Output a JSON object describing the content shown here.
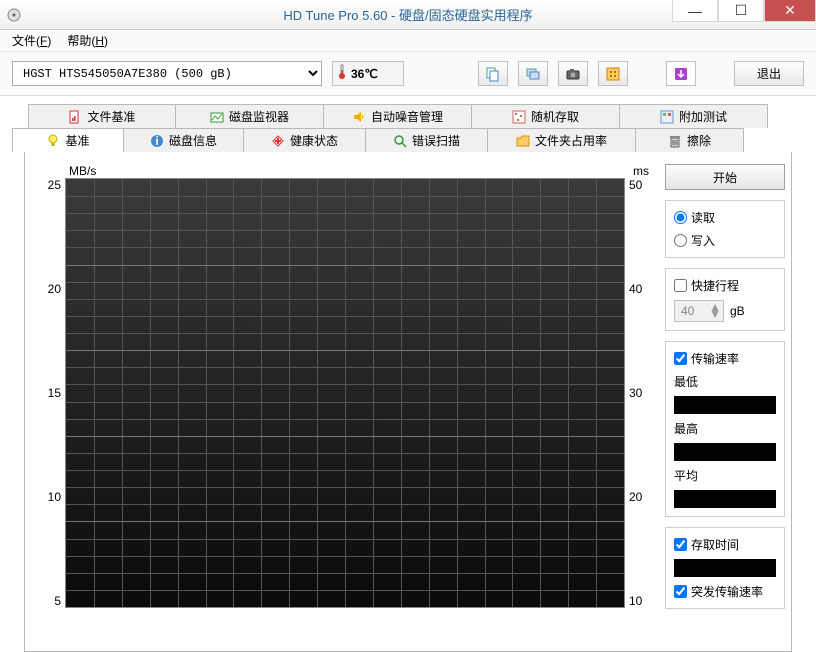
{
  "titlebar": {
    "title": "HD Tune Pro 5.60 - 硬盘/固态硬盘实用程序"
  },
  "menubar": {
    "file": "文件",
    "file_accel": "F",
    "help": "帮助",
    "help_accel": "H"
  },
  "toolbar": {
    "drive": "HGST HTS545050A7E380 (500 gB)",
    "temp": "36℃",
    "exit": "退出"
  },
  "tabs_row1": [
    {
      "label": "文件基准"
    },
    {
      "label": "磁盘监视器"
    },
    {
      "label": "自动噪音管理"
    },
    {
      "label": "随机存取"
    },
    {
      "label": "附加测试"
    }
  ],
  "tabs_row2": [
    {
      "label": "基准"
    },
    {
      "label": "磁盘信息"
    },
    {
      "label": "健康状态"
    },
    {
      "label": "错误扫描"
    },
    {
      "label": "文件夹占用率"
    },
    {
      "label": "擦除"
    }
  ],
  "chart": {
    "left_unit": "MB/s",
    "right_unit": "ms",
    "y_left": [
      "25",
      "20",
      "15",
      "10",
      "5"
    ],
    "y_right": [
      "50",
      "40",
      "30",
      "20",
      "10"
    ]
  },
  "side": {
    "start": "开始",
    "read": "读取",
    "write": "写入",
    "shortstroke": "快捷行程",
    "shortstroke_value": "40",
    "shortstroke_unit": "gB",
    "transfer_rate": "传输速率",
    "min": "最低",
    "max": "最高",
    "avg": "平均",
    "access_time": "存取时间",
    "burst_rate": "突发传输速率"
  },
  "chart_data": {
    "type": "line",
    "title": "",
    "xlabel": "",
    "ylabel_left": "MB/s",
    "ylabel_right": "ms",
    "ylim_left": [
      0,
      25
    ],
    "ylim_right": [
      0,
      50
    ],
    "series": [
      {
        "name": "transfer_rate",
        "axis": "left",
        "values": []
      },
      {
        "name": "access_time",
        "axis": "right",
        "values": []
      }
    ]
  }
}
